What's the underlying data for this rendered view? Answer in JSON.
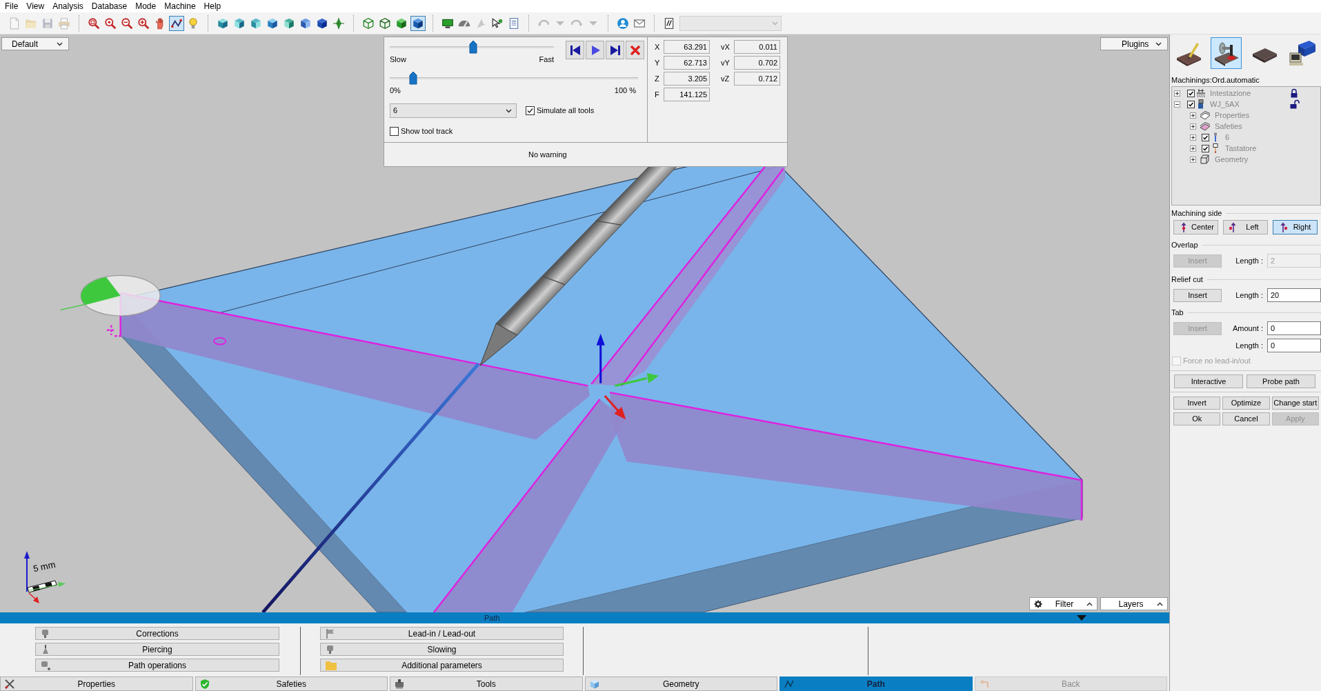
{
  "menu": [
    "File",
    "View",
    "Analysis",
    "Database",
    "Mode",
    "Machine",
    "Help"
  ],
  "toolbar": {
    "groups": [
      [
        {
          "selected": false,
          "disabled": true
        },
        {
          "selected": false,
          "disabled": true
        },
        {
          "selected": false,
          "disabled": true
        },
        {
          "selected": false,
          "disabled": true
        }
      ],
      [
        {
          "selected": false,
          "disabled": false
        },
        {
          "selected": false,
          "disabled": false
        },
        {
          "selected": false,
          "disabled": false
        },
        {
          "selected": false,
          "disabled": false
        },
        {
          "selected": false,
          "disabled": false
        },
        {
          "selected": true,
          "disabled": false
        },
        {
          "selected": false,
          "disabled": false
        }
      ],
      [
        {
          "selected": false,
          "disabled": false
        },
        {
          "selected": false,
          "disabled": false
        },
        {
          "selected": false,
          "disabled": false
        },
        {
          "selected": false,
          "disabled": false
        },
        {
          "selected": false,
          "disabled": false
        },
        {
          "selected": false,
          "disabled": false
        },
        {
          "selected": false,
          "disabled": false
        },
        {
          "selected": false,
          "disabled": false
        }
      ],
      [
        {
          "selected": false,
          "disabled": false
        },
        {
          "selected": false,
          "disabled": false
        },
        {
          "selected": false,
          "disabled": false
        },
        {
          "selected": true,
          "disabled": false
        }
      ],
      [
        {
          "selected": false,
          "disabled": false
        },
        {
          "selected": false,
          "disabled": false
        },
        {
          "selected": false,
          "disabled": true
        },
        {
          "selected": false,
          "disabled": false
        },
        {
          "selected": false,
          "disabled": false
        }
      ],
      [
        {
          "selected": false,
          "disabled": true
        },
        {
          "selected": false,
          "disabled": true
        },
        {
          "selected": false,
          "disabled": true
        },
        {
          "selected": false,
          "disabled": true
        }
      ],
      [
        {
          "selected": false,
          "disabled": false
        },
        {
          "selected": false,
          "disabled": false
        }
      ],
      [
        {
          "selected": false,
          "disabled": false
        }
      ]
    ],
    "combo": {
      "disabled": true
    }
  },
  "viewport": {
    "view_preset": "Default",
    "plugins": "Plugins",
    "filter": "Filter",
    "layers": "Layers",
    "scale_label": "5 mm"
  },
  "simulation": {
    "speed": {
      "level": 0.51,
      "min_label": "Slow",
      "max_label": "Fast"
    },
    "progress": {
      "level": 0.08,
      "min_label": "0%",
      "max_label": "100 %"
    },
    "tool": "6",
    "simulate_all_tools": {
      "label": "Simulate all tools",
      "checked": true
    },
    "show_tool_track": {
      "label": "Show tool track",
      "checked": false
    },
    "position": [
      {
        "label": "X",
        "value": "63.291"
      },
      {
        "label": "Y",
        "value": "62.713"
      },
      {
        "label": "Z",
        "value": "3.205"
      },
      {
        "label": "F",
        "value": "141.125"
      }
    ],
    "velocity": [
      {
        "label": "vX",
        "value": "0.011"
      },
      {
        "label": "vY",
        "value": "0.702"
      },
      {
        "label": "vZ",
        "value": "0.712"
      }
    ],
    "status": "No warning"
  },
  "right_panel": {
    "machine_tabs": [
      {
        "selected": false
      },
      {
        "selected": true
      },
      {
        "selected": false
      },
      {
        "selected": false
      }
    ],
    "title": "Machinings:Ord.automatic",
    "tree": [
      {
        "label": "Intestazione",
        "kind": "checkable",
        "checked": true,
        "expanded": false,
        "locked": true
      },
      {
        "label": "WJ_5AX",
        "kind": "checkable",
        "checked": true,
        "expanded": true,
        "locked": false,
        "children": [
          {
            "label": "Properties",
            "kind": "plain",
            "expanded": false
          },
          {
            "label": "Safeties",
            "kind": "plain",
            "expanded": false
          },
          {
            "label": "6",
            "kind": "checkable",
            "checked": true,
            "expanded": false
          },
          {
            "label": "Tastatore",
            "kind": "checkable",
            "checked": true,
            "expanded": false
          },
          {
            "label": "Geometry",
            "kind": "plain",
            "expanded": false
          }
        ]
      }
    ],
    "machining_side": {
      "title": "Machining side",
      "options": [
        {
          "label": "Center",
          "selected": false
        },
        {
          "label": "Left",
          "selected": false
        },
        {
          "label": "Right",
          "selected": true
        }
      ]
    },
    "groups": [
      {
        "title": "Overlap",
        "insert": {
          "label": "Insert",
          "disabled": true
        },
        "fields": [
          {
            "label": "Length :",
            "value": "2",
            "disabled": true
          }
        ]
      },
      {
        "title": "Relief cut",
        "insert": {
          "label": "Insert",
          "disabled": false
        },
        "fields": [
          {
            "label": "Length :",
            "value": "20",
            "disabled": false
          }
        ]
      },
      {
        "title": "Tab",
        "insert": {
          "label": "Insert",
          "disabled": true
        },
        "fields": [
          {
            "label": "Amount :",
            "value": "0",
            "disabled": false
          },
          {
            "label": "Length :",
            "value": "0",
            "disabled": false
          }
        ]
      }
    ],
    "force_no_lead": {
      "label": "Force no lead-in/out",
      "checked": false,
      "disabled": true
    },
    "actions": [
      [
        {
          "label": "Interactive",
          "disabled": false
        },
        {
          "label": "Probe path",
          "disabled": false
        }
      ],
      [
        {
          "label": "Invert",
          "disabled": false
        },
        {
          "label": "Optimize",
          "disabled": false
        },
        {
          "label": "Change start",
          "disabled": false
        }
      ],
      [
        {
          "label": "Ok",
          "disabled": false
        },
        {
          "label": "Cancel",
          "disabled": false
        },
        {
          "label": "Apply",
          "disabled": true
        }
      ]
    ]
  },
  "path_panel": {
    "title": "Path",
    "columns": [
      [
        "Corrections",
        "Piercing",
        "Path operations"
      ],
      [
        "Lead-in / Lead-out",
        "Slowing",
        "Additional parameters"
      ]
    ]
  },
  "bottom_tabs": [
    {
      "label": "Properties",
      "selected": false,
      "disabled": false
    },
    {
      "label": "Safeties",
      "selected": false,
      "disabled": false
    },
    {
      "label": "Tools",
      "selected": false,
      "disabled": false
    },
    {
      "label": "Geometry",
      "selected": false,
      "disabled": false
    },
    {
      "label": "Path",
      "selected": true,
      "disabled": false
    },
    {
      "label": "Back",
      "selected": false,
      "disabled": true
    }
  ]
}
